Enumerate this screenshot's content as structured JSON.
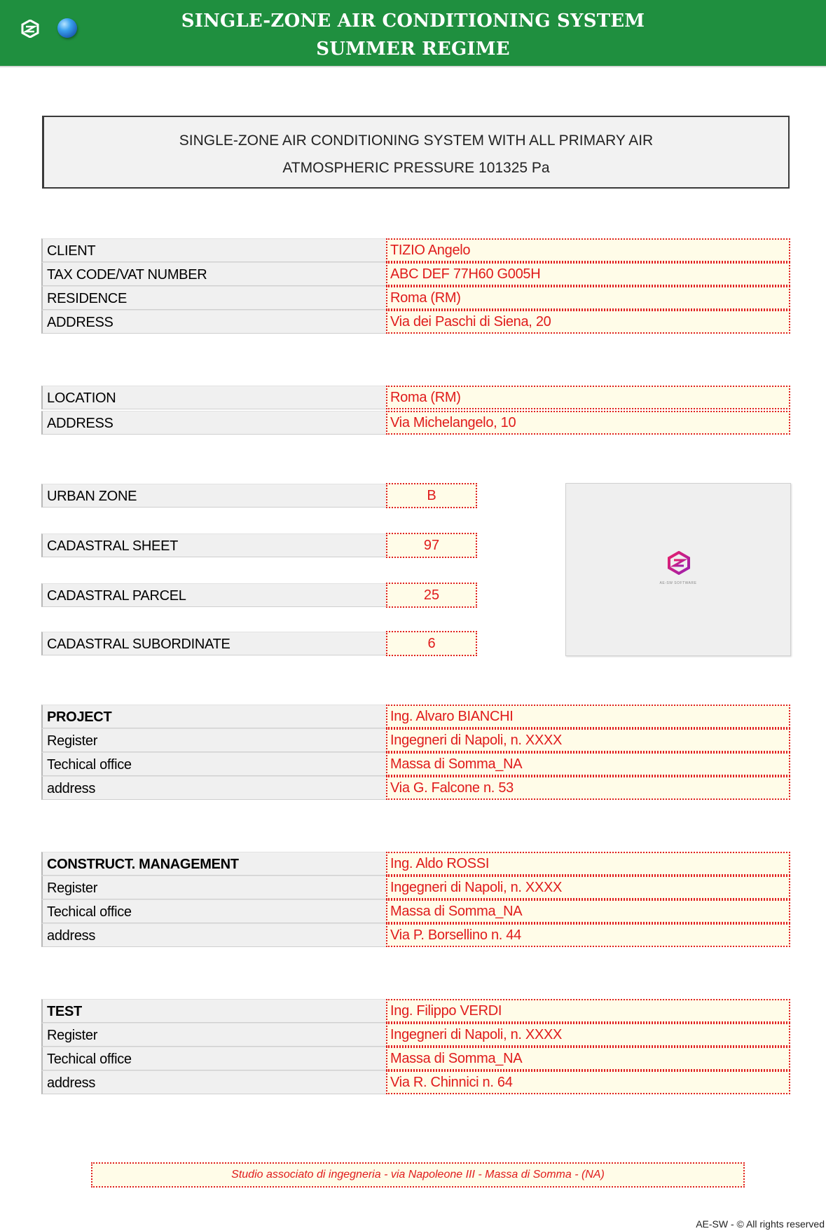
{
  "header": {
    "title_line1": "SINGLE-ZONE AIR CONDITIONING SYSTEM",
    "title_line2": "SUMMER REGIME"
  },
  "description": {
    "line1": "SINGLE-ZONE AIR CONDITIONING SYSTEM WITH ALL PRIMARY AIR",
    "line2": "ATMOSPHERIC PRESSURE 101325 Pa"
  },
  "client": {
    "client_label": "CLIENT",
    "client_value": "TIZIO Angelo",
    "tax_label": "TAX CODE/VAT NUMBER",
    "tax_value": "ABC DEF 77H60 G005H",
    "residence_label": "RESIDENCE",
    "residence_value": "Roma (RM)",
    "address_label": "ADDRESS",
    "address_value": "Via dei Paschi di Siena, 20"
  },
  "location": {
    "location_label": "LOCATION",
    "location_value": "Roma (RM)",
    "address_label": "ADDRESS",
    "address_value": "Via Michelangelo, 10"
  },
  "cadastral": {
    "urban_zone_label": "URBAN ZONE",
    "urban_zone_value": "B",
    "sheet_label": "CADASTRAL SHEET",
    "sheet_value": "97",
    "parcel_label": "CADASTRAL PARCEL",
    "parcel_value": "25",
    "subordinate_label": "CADASTRAL SUBORDINATE",
    "subordinate_value": "6"
  },
  "project": {
    "label": "PROJECT",
    "value": "Ing. Alvaro BIANCHI",
    "register_label": "Register",
    "register_value": "Ingegneri di Napoli, n. XXXX",
    "office_label": "Techical office",
    "office_value": "Massa di Somma_NA",
    "address_label": "address",
    "address_value": "Via G. Falcone n. 53"
  },
  "management": {
    "label": "CONSTRUCT. MANAGEMENT",
    "value": "Ing. Aldo ROSSI",
    "register_label": "Register",
    "register_value": "Ingegneri di Napoli, n. XXXX",
    "office_label": "Techical office",
    "office_value": "Massa di Somma_NA",
    "address_label": "address",
    "address_value": "Via P. Borsellino n. 44"
  },
  "test": {
    "label": "TEST",
    "value": "Ing. Filippo VERDI",
    "register_label": "Register",
    "register_value": "Ingegneri di Napoli, n. XXXX",
    "office_label": "Techical office",
    "office_value": "Massa di Somma_NA",
    "address_label": "address",
    "address_value": "Via R. Chinnici n. 64"
  },
  "footer": {
    "studio": "Studio associato di ingegneria - via Napoleone III - Massa di Somma - (NA)",
    "copyright": "AE-SW - © All rights reserved"
  },
  "colors": {
    "banner": "#1f8f3f",
    "value_text": "#e01b1b",
    "value_fill": "#fffce8",
    "label_fill": "#f0f0f0"
  },
  "icons": [
    "ae-sw-logo-icon",
    "globe-icon"
  ]
}
